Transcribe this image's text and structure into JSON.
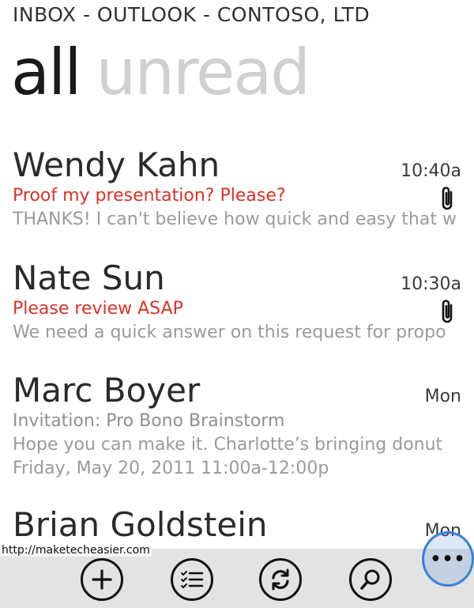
{
  "header": {
    "app_title": "INBOX - OUTLOOK - CONTOSO, LTD"
  },
  "pivot": {
    "items": [
      {
        "label": "all",
        "active": true
      },
      {
        "label": "unread",
        "active": false
      }
    ]
  },
  "messages": [
    {
      "sender": "Wendy Kahn",
      "time": "10:40a",
      "subject": "Proof my presentation? Please?",
      "preview": "THANKS! I can't believe how quick and easy that w",
      "unread": true,
      "has_attachment": true,
      "icon": "paperclip-icon"
    },
    {
      "sender": "Nate Sun",
      "time": "10:30a",
      "subject": "Please review ASAP",
      "preview": "We need a quick answer on this request for propo",
      "unread": true,
      "has_attachment": true,
      "icon": "paperclip-icon"
    },
    {
      "sender": "Marc Boyer",
      "time": "Mon",
      "subject": "Invitation: Pro Bono Brainstorm",
      "preview": "Hope you can make it. Charlotte’s bringing donut",
      "preview_line2": "Friday, May 20, 2011 11:00a-12:00p",
      "unread": false,
      "has_attachment": false
    },
    {
      "sender": "Brian Goldstein",
      "time": "Mon",
      "unread": false,
      "has_attachment": false
    }
  ],
  "appbar": {
    "watermark": "http://maketecheasier.com",
    "buttons": [
      {
        "name": "new-message-button",
        "icon": "plus-icon"
      },
      {
        "name": "select-button",
        "icon": "checklist-icon"
      },
      {
        "name": "sync-button",
        "icon": "sync-icon"
      },
      {
        "name": "search-button",
        "icon": "search-icon"
      }
    ],
    "more_label": "•••"
  },
  "colors": {
    "accent_unread": "#d9322a",
    "pivot_inactive": "#d0d0d0",
    "appbar_bg": "#e3e3e3",
    "more_highlight": "#3a7fd9"
  }
}
